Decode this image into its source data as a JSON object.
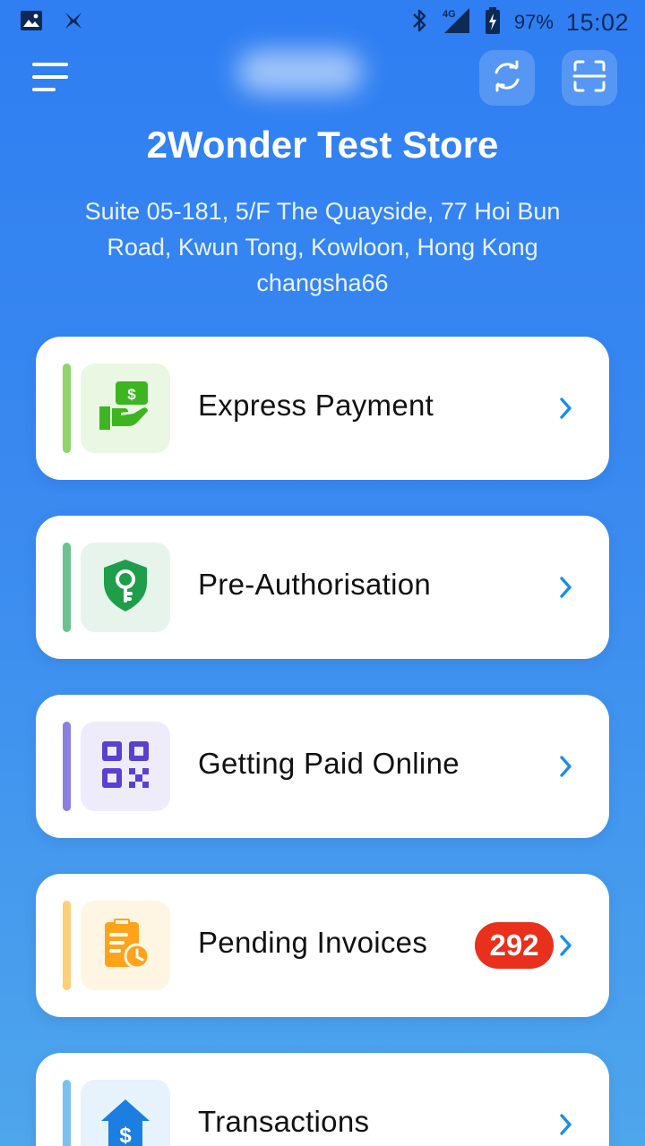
{
  "status_bar": {
    "icons": [
      "image-icon",
      "app-icon",
      "bluetooth-icon",
      "signal-4g-icon",
      "battery-icon"
    ],
    "network": "4G",
    "battery": "97%",
    "time": "15:02"
  },
  "header": {
    "store_name": "2Wonder Test Store",
    "address_line1": "Suite 05-181, 5/F The Quayside, 77 Hoi Bun",
    "address_line2": "Road, Kwun Tong, Kowloon, Hong Kong",
    "username": "changsha66"
  },
  "menu": [
    {
      "label": "Express Payment",
      "icon": "cash-hand-icon",
      "accent": "#8fd46c",
      "tile": "#eaf7e3"
    },
    {
      "label": "Pre-Authorisation",
      "icon": "shield-key-icon",
      "accent": "#6cc28e",
      "tile": "#e6f4ec"
    },
    {
      "label": "Getting Paid Online",
      "icon": "qr-code-icon",
      "accent": "#8b7fe0",
      "tile": "#eeebfb"
    },
    {
      "label": "Pending Invoices",
      "icon": "invoice-clock-icon",
      "accent": "#ffcf7a",
      "tile": "#fff5e3",
      "badge": "292"
    },
    {
      "label": "Transactions",
      "icon": "house-dollar-icon",
      "accent": "#7cc0f2",
      "tile": "#e6f2fc"
    }
  ],
  "colors": {
    "primary_blue": "#2f7ef2",
    "chevron": "#1a8fe8",
    "badge_red": "#e8301c"
  }
}
